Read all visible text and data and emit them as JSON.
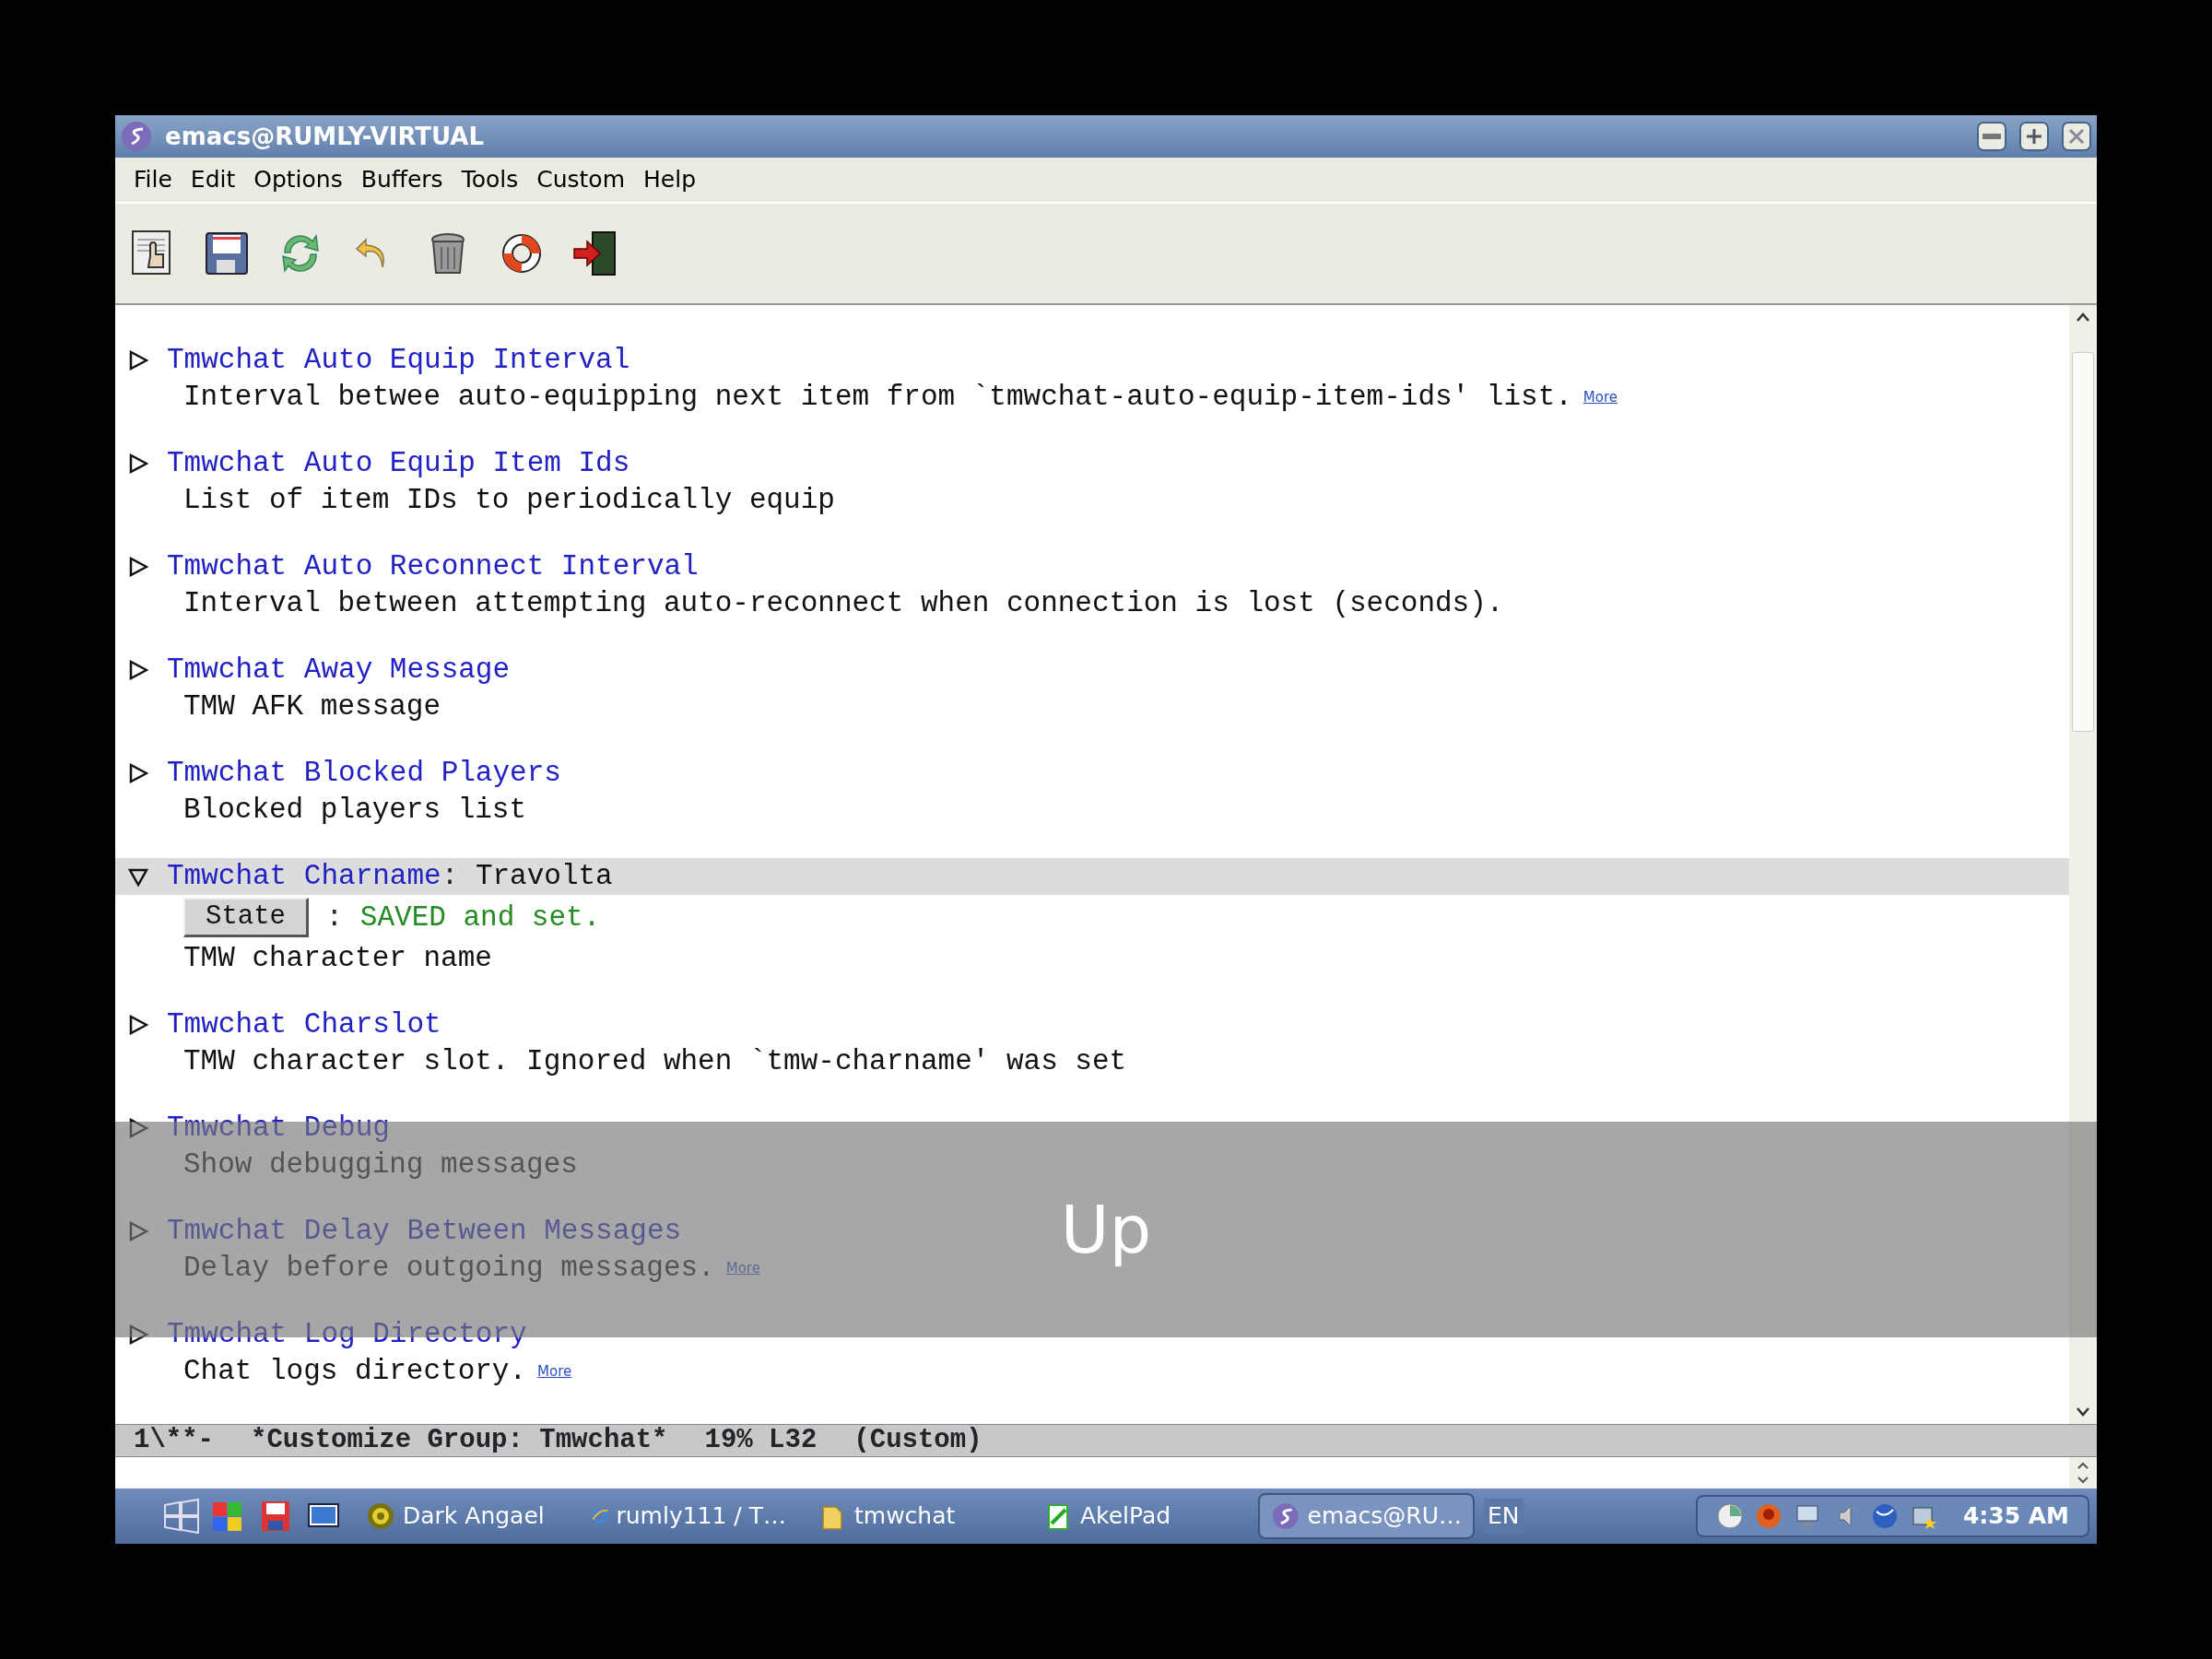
{
  "window": {
    "title": "emacs@RUMLY-VIRTUAL"
  },
  "menu": [
    "File",
    "Edit",
    "Options",
    "Buffers",
    "Tools",
    "Custom",
    "Help"
  ],
  "entries": [
    {
      "title": "Tmwchat Auto Equip Interval",
      "expanded": false,
      "description": "Interval betwee auto-equipping next item from `tmwchat-auto-equip-item-ids' list.",
      "more": "More"
    },
    {
      "title": "Tmwchat Auto Equip Item Ids",
      "expanded": false,
      "description": "List of item IDs to periodically equip"
    },
    {
      "title": "Tmwchat Auto Reconnect Interval",
      "expanded": false,
      "description": "Interval between attempting auto-reconnect when connection is lost (seconds)."
    },
    {
      "title": "Tmwchat Away Message",
      "expanded": false,
      "description": "TMW AFK message"
    },
    {
      "title": "Tmwchat Blocked Players",
      "expanded": false,
      "description": "Blocked players list"
    },
    {
      "title": "Tmwchat Charname",
      "expanded": true,
      "value_separator": ":",
      "value": "Travolta",
      "state_button": "State",
      "state_separator": ":",
      "state_text": "SAVED and set.",
      "description": "TMW character name"
    },
    {
      "title": "Tmwchat Charslot",
      "expanded": false,
      "description": "TMW character slot. Ignored when `tmw-charname' was set"
    },
    {
      "title": "Tmwchat Debug",
      "expanded": false,
      "description": "Show debugging messages"
    },
    {
      "title": "Tmwchat Delay Between Messages",
      "expanded": false,
      "description": "Delay before outgoing messages.",
      "more": "More"
    },
    {
      "title": "Tmwchat Log Directory",
      "expanded": false,
      "description": "Chat logs directory.",
      "more": "More"
    }
  ],
  "overlay": {
    "label": "Up"
  },
  "mode_line": [
    "1\\**-",
    "*Customize Group: Tmwchat*",
    "19% L32",
    "(Custom)"
  ],
  "taskbar": {
    "tasks": [
      {
        "label": "Dark Angael",
        "selected": false
      },
      {
        "label": "rumly111 / T…",
        "selected": false
      },
      {
        "label": "tmwchat",
        "selected": false
      },
      {
        "label": "AkelPad",
        "selected": false
      },
      {
        "label": "emacs@RU…",
        "selected": true
      }
    ],
    "language": "EN",
    "clock": "4:35 AM"
  }
}
